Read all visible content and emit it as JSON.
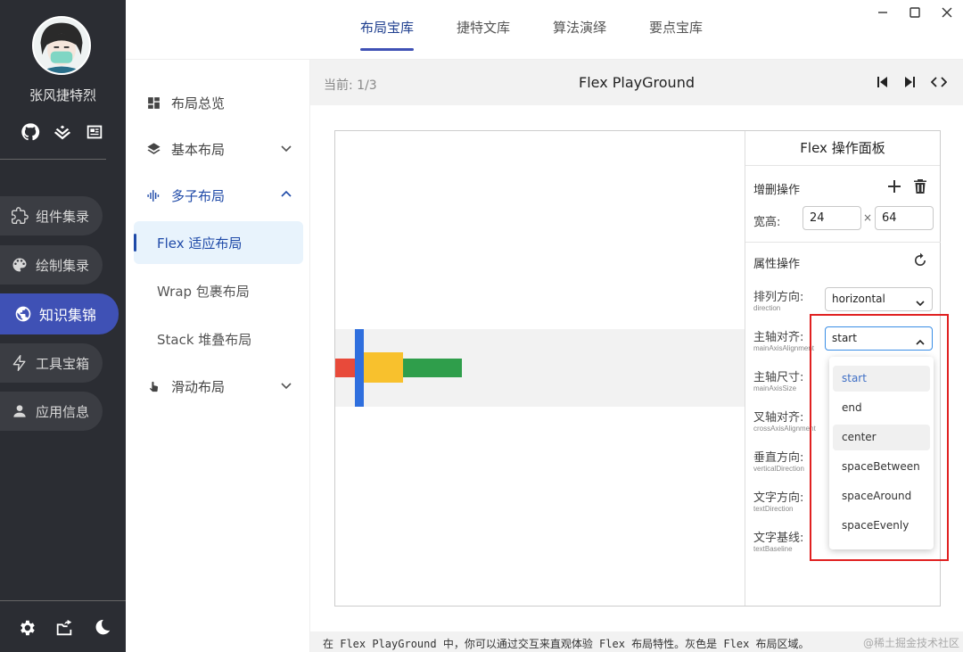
{
  "user": {
    "name": "张风捷特烈"
  },
  "rail": {
    "items": [
      {
        "label": "组件集录",
        "icon": "puzzle-icon"
      },
      {
        "label": "绘制集录",
        "icon": "palette-icon"
      },
      {
        "label": "知识集锦",
        "icon": "globe-icon",
        "active": true
      },
      {
        "label": "工具宝箱",
        "icon": "bolt-icon"
      },
      {
        "label": "应用信息",
        "icon": "person-icon"
      }
    ]
  },
  "topbar": {
    "tabs": [
      {
        "label": "布局宝库",
        "active": true
      },
      {
        "label": "捷特文库"
      },
      {
        "label": "算法演绎"
      },
      {
        "label": "要点宝库"
      }
    ]
  },
  "sidebar": {
    "items": [
      {
        "label": "布局总览",
        "icon": "dashboard-icon"
      },
      {
        "label": "基本布局",
        "icon": "layers-icon"
      },
      {
        "label": "多子布局",
        "icon": "waveform-icon",
        "open": true
      },
      {
        "label": "滑动布局",
        "icon": "swipe-icon"
      }
    ],
    "sub_items": [
      {
        "label": "Flex 适应布局",
        "active": true
      },
      {
        "label": "Wrap 包裹布局"
      },
      {
        "label": "Stack 堆叠布局"
      }
    ]
  },
  "main": {
    "counter": "当前: 1/3",
    "title": "Flex PlayGround"
  },
  "panel": {
    "title": "Flex 操作面板",
    "add_delete_heading": "增删操作",
    "size_label": "宽高:",
    "width": "24",
    "times": "×",
    "height": "64",
    "props_heading": "属性操作",
    "props": [
      {
        "label": "排列方向:",
        "sub": "direction",
        "value": "horizontal"
      },
      {
        "label": "主轴对齐:",
        "sub": "mainAxisAlignment",
        "value": "start"
      },
      {
        "label": "主轴尺寸:",
        "sub": "mainAxisSize"
      },
      {
        "label": "叉轴对齐:",
        "sub": "crossAxisAlignment"
      },
      {
        "label": "垂直方向:",
        "sub": "verticalDirection"
      },
      {
        "label": "文字方向:",
        "sub": "textDirection"
      },
      {
        "label": "文字基线:",
        "sub": "textBaseline"
      }
    ]
  },
  "dropdown": {
    "options": [
      "start",
      "end",
      "center",
      "spaceBetween",
      "spaceAround",
      "spaceEvenly"
    ],
    "selected": "start"
  },
  "flex_children": [
    {
      "color": "#e84a3a"
    },
    {
      "color": "#2f6fde"
    },
    {
      "color": "#f8c12d"
    },
    {
      "color": "#2f9e4b"
    }
  ],
  "footer": {
    "text": "在 Flex PlayGround 中，你可以通过交互来直观体验 Flex 布局特性。灰色是 Flex 布局区域。",
    "watermark": "@稀土掘金技术社区"
  },
  "colors": {
    "accent": "#3f51b5",
    "highlight": "#e02020"
  }
}
